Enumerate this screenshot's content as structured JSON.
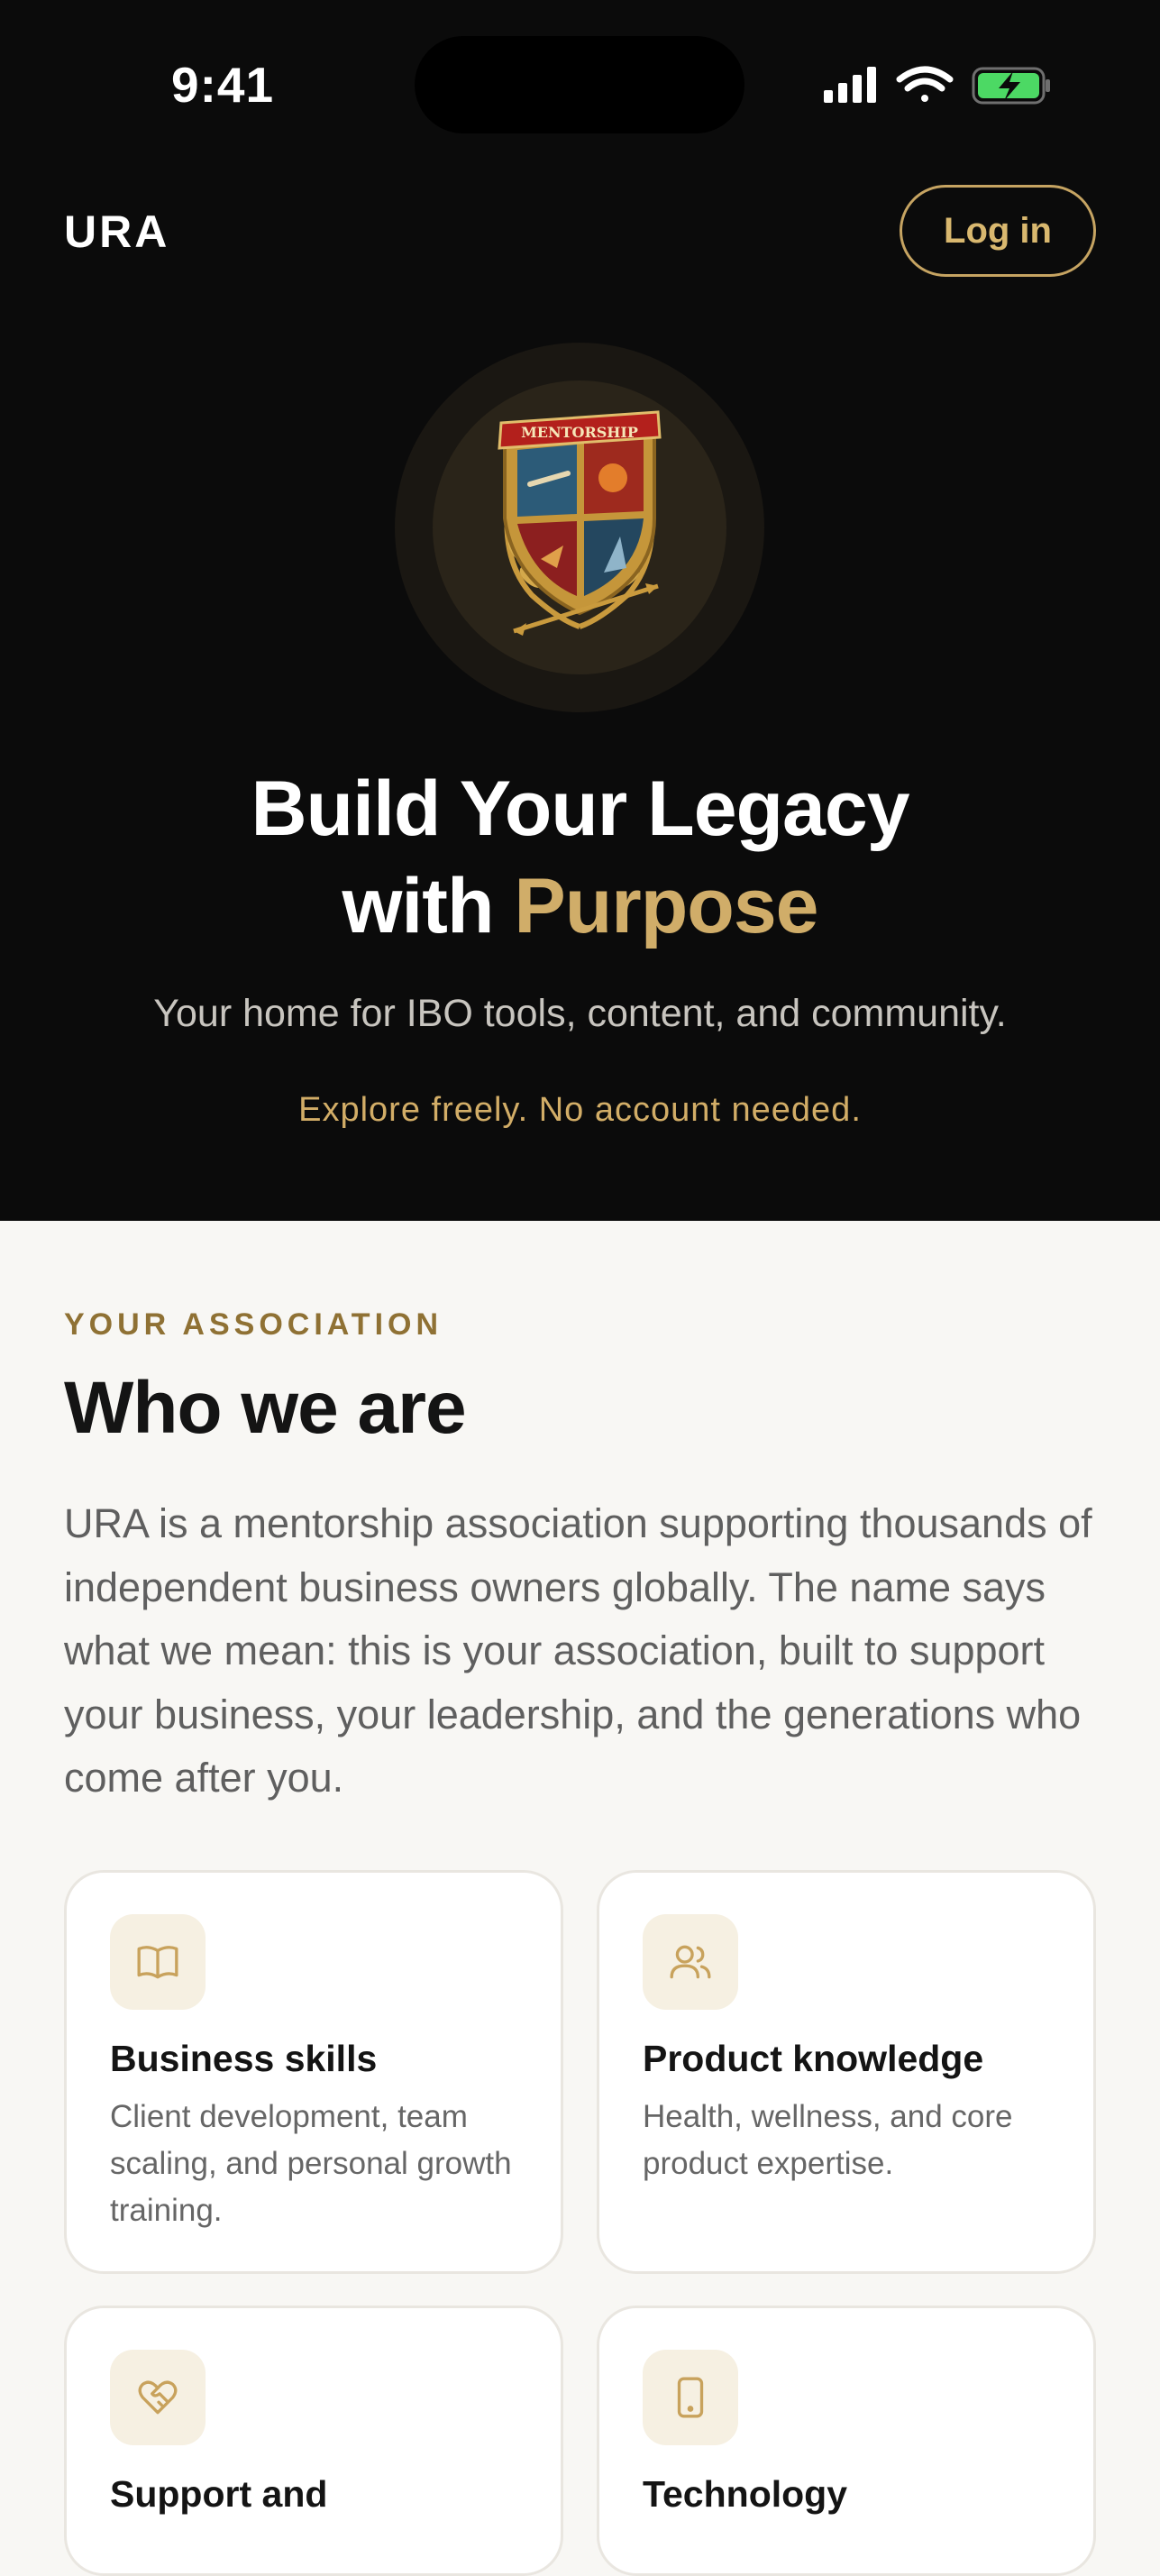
{
  "status_bar": {
    "time": "9:41"
  },
  "header": {
    "brand": "URA",
    "login_label": "Log in"
  },
  "hero": {
    "emblem_text": "MENTORSHIP",
    "headline_line1": "Build Your Legacy",
    "headline_with": "with",
    "headline_accent": "Purpose",
    "tagline": "Your home for IBO tools, content, and community.",
    "explore": "Explore freely. No account needed."
  },
  "about": {
    "eyebrow": "YOUR ASSOCIATION",
    "title": "Who we are",
    "description": "URA is a mentorship association supporting thousands of independent business owners globally. The name says what we mean: this is your association, built to support your business, your leadership, and the generations who come after you."
  },
  "features": [
    {
      "icon": "book-icon",
      "title": "Business skills",
      "description": "Client development, team scaling, and personal growth training."
    },
    {
      "icon": "users-icon",
      "title": "Product knowledge",
      "description": "Health, wellness, and core product expertise."
    },
    {
      "icon": "heart-handshake-icon",
      "title": "Support and",
      "description": ""
    },
    {
      "icon": "smartphone-icon",
      "title": "Technology",
      "description": ""
    }
  ],
  "colors": {
    "accent": "#d0ad69",
    "hero_bg": "#0b0b0b",
    "page_bg": "#f8f7f4"
  }
}
